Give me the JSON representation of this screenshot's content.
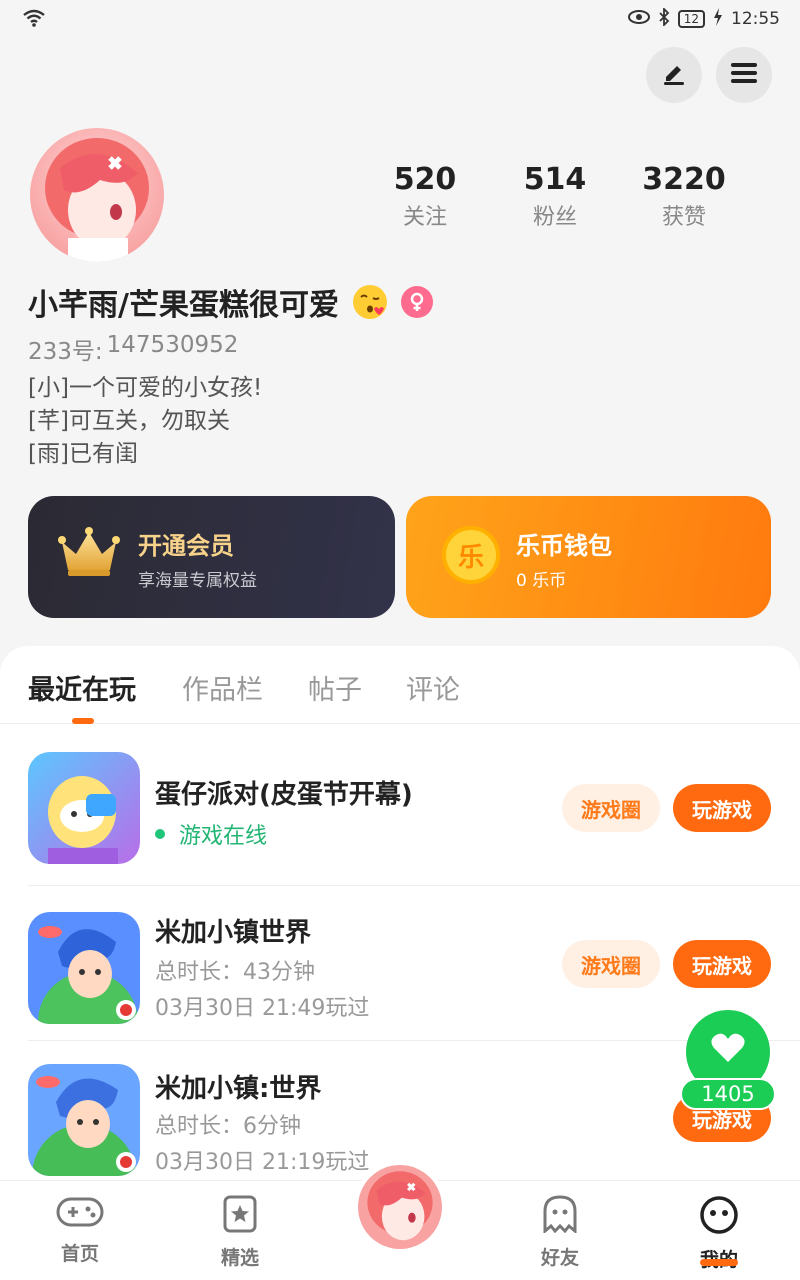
{
  "status_bar": {
    "time": "12:55",
    "battery": "12"
  },
  "profile": {
    "username": "小芊雨/芒果蛋糕很可爱",
    "account_id_label": "233号:",
    "account_id": "147530952",
    "bio": [
      "[小]一个可爱的小女孩!",
      "[芊]可互关，勿取关",
      "[雨]已有闺"
    ],
    "stats": [
      {
        "value": "520",
        "label": "关注"
      },
      {
        "value": "514",
        "label": "粉丝"
      },
      {
        "value": "3220",
        "label": "获赞"
      }
    ]
  },
  "cards": {
    "vip": {
      "title": "开通会员",
      "subtitle": "享海量专属权益"
    },
    "wallet": {
      "title": "乐币钱包",
      "subtitle": "0 乐币",
      "coin_glyph": "乐"
    }
  },
  "tabs": [
    "最近在玩",
    "作品栏",
    "帖子",
    "评论"
  ],
  "games": [
    {
      "name": "蛋仔派对(皮蛋节开幕)",
      "status": "游戏在线",
      "circle_label": "游戏圈",
      "play_label": "玩游戏"
    },
    {
      "name": "米加小镇世界",
      "duration": "总时长：43分钟",
      "last_played": "03月30日 21:49玩过",
      "circle_label": "游戏圈",
      "play_label": "玩游戏"
    },
    {
      "name": "米加小镇:世界",
      "duration": "总时长：6分钟",
      "last_played": "03月30日 21:19玩过",
      "play_label": "玩游戏"
    }
  ],
  "like_count": "1405",
  "nav": [
    {
      "label": "首页"
    },
    {
      "label": "精选"
    },
    {
      "label": "好友"
    },
    {
      "label": "我的"
    }
  ],
  "colors": {
    "accent": "#ff6a10",
    "like": "#1ccd55",
    "online": "#22b573"
  }
}
